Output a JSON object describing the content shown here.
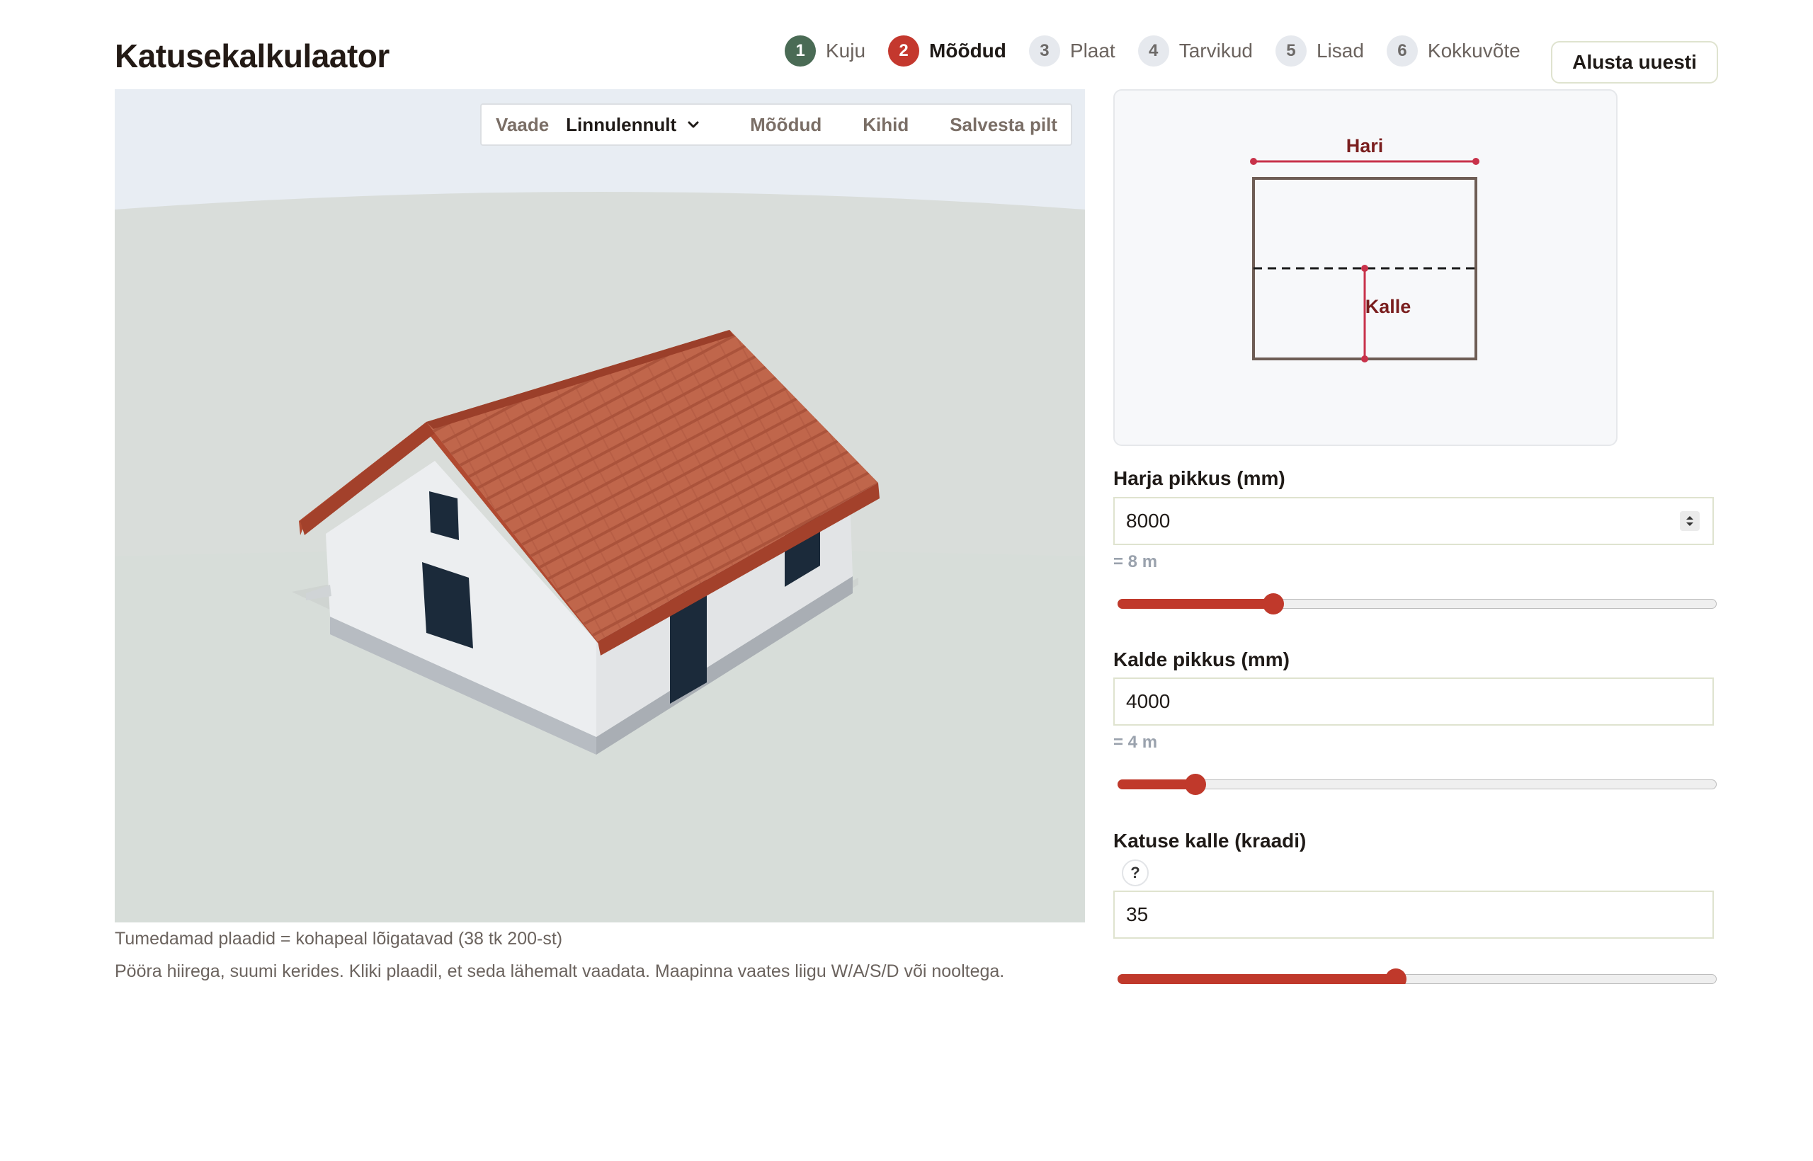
{
  "header": {
    "title": "Katusekalkulaator",
    "restart_label": "Alusta uuesti",
    "steps": [
      {
        "num": "1",
        "label": "Kuju",
        "state": "done"
      },
      {
        "num": "2",
        "label": "Mõõdud",
        "state": "active"
      },
      {
        "num": "3",
        "label": "Plaat",
        "state": "pending"
      },
      {
        "num": "4",
        "label": "Tarvikud",
        "state": "pending"
      },
      {
        "num": "5",
        "label": "Lisad",
        "state": "pending"
      },
      {
        "num": "6",
        "label": "Kokkuvõte",
        "state": "pending"
      }
    ]
  },
  "viewer": {
    "view_label": "Vaade",
    "view_value": "Linnulennult",
    "dimensions_btn": "Mõõdud",
    "layers_btn": "Kihid",
    "save_btn": "Salvesta pilt",
    "note_cut": "Tumedamad plaadid = kohapeal lõigatavad (38 tk 200-st)",
    "note_help": "Pööra hiirega, suumi kerides. Kliki plaadil, et seda lähemalt vaadata. Maapinna vaates liigu W/A/S/D või nooltega."
  },
  "diagram": {
    "ridge_label": "Hari",
    "slope_label": "Kalle"
  },
  "form": {
    "ridge": {
      "label": "Harja pikkus (mm)",
      "value": "8000",
      "hint": "= 8 m",
      "slider_fraction": 0.26
    },
    "slope": {
      "label": "Kalde pikkus (mm)",
      "value": "4000",
      "hint": "= 4 m",
      "slider_fraction": 0.13
    },
    "pitch": {
      "label": "Katuse kalle (kraadi)",
      "help": "?",
      "value": "35",
      "slider_fraction": 0.465
    }
  },
  "colors": {
    "accent": "#c0392b",
    "done_step": "#4a6b55",
    "roof": "#c0654a",
    "window": "#1b2a3a"
  }
}
